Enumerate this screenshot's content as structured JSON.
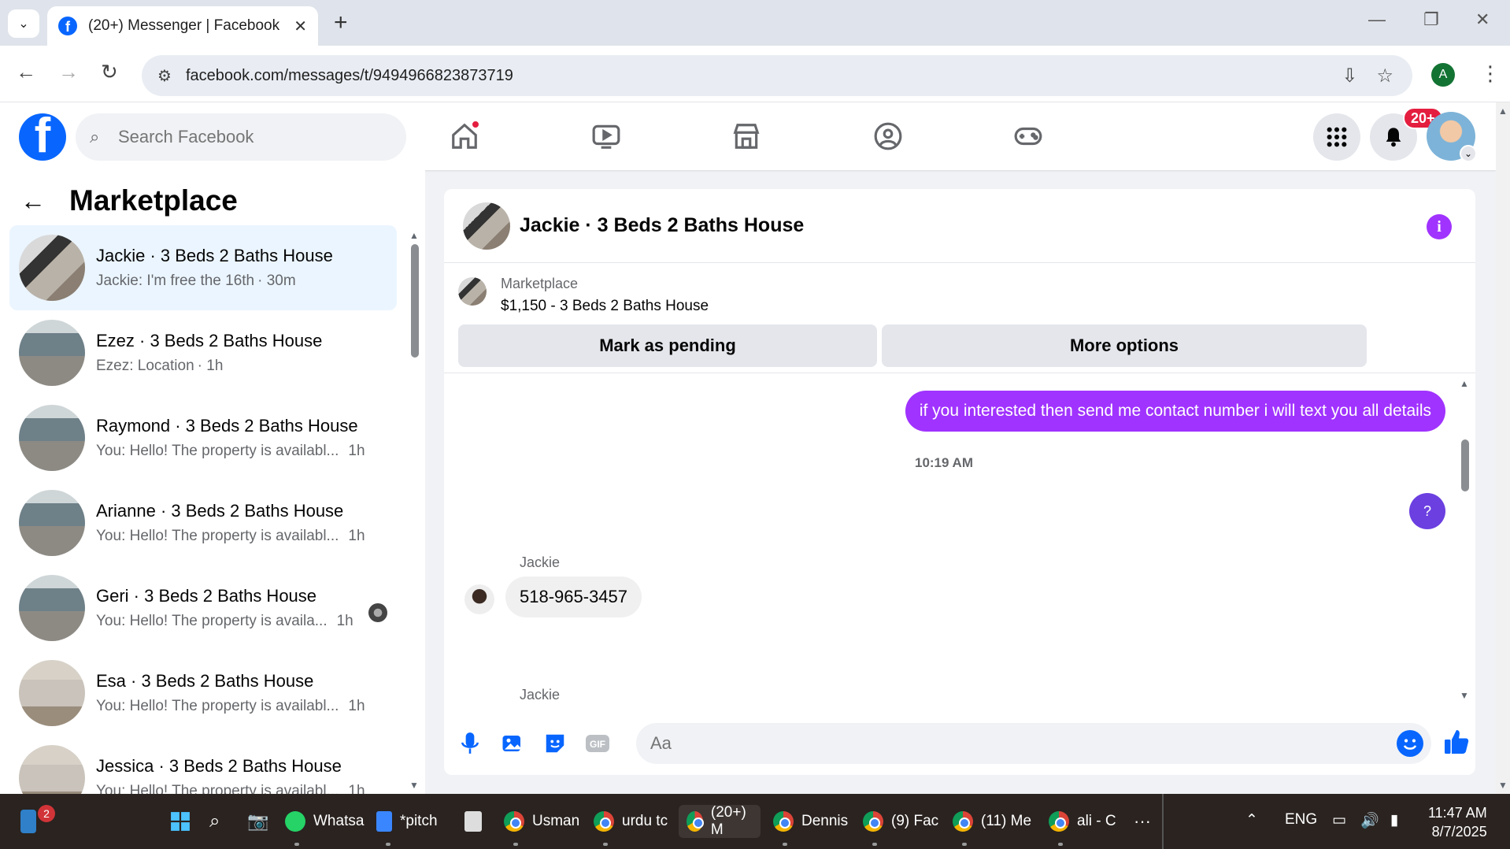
{
  "browser": {
    "tab_title": "(20+) Messenger | Facebook",
    "url": "facebook.com/messages/t/9494966823873719",
    "profile_initial": "A"
  },
  "fb": {
    "search_placeholder": "Search Facebook",
    "notification_badge": "20+"
  },
  "left_pane": {
    "title": "Marketplace",
    "conversations": [
      {
        "name": "Jackie · 3 Beds 2 Baths House",
        "preview": "Jackie: I'm free the 16th",
        "time": "· 30m",
        "active": true
      },
      {
        "name": "Ezez · 3 Beds 2 Baths House",
        "preview": "Ezez: Location",
        "time": "· 1h"
      },
      {
        "name": "Raymond · 3 Beds 2 Baths House",
        "preview": "You: Hello! The property is availabl...",
        "time": "1h"
      },
      {
        "name": "Arianne · 3 Beds 2 Baths House",
        "preview": "You: Hello! The property is availabl...",
        "time": "1h"
      },
      {
        "name": "Geri · 3 Beds 2 Baths House",
        "preview": "You: Hello! The property is availa...",
        "time": "1h"
      },
      {
        "name": "Esa · 3 Beds 2 Baths House",
        "preview": "You: Hello! The property is availabl...",
        "time": "1h"
      },
      {
        "name": "Jessica · 3 Beds 2 Baths House",
        "preview": "You: Hello! The property is availabl...",
        "time": "1h"
      }
    ]
  },
  "chat": {
    "title": "Jackie · 3 Beds 2 Baths House",
    "marketplace_label": "Marketplace",
    "listing": "$1,150 - 3 Beds 2 Baths House",
    "btn_pending": "Mark as pending",
    "btn_more": "More options",
    "outgoing_msg": "if you interested then send me contact number i will text you all details",
    "timestamp": "10:19 AM",
    "question_bubble": "?",
    "sender1": "Jackie",
    "incoming_msg": "518-965-3457",
    "sender2": "Jackie",
    "composer_placeholder": "Aa"
  },
  "taskbar": {
    "notif_count": "2",
    "items": [
      {
        "label": "Whatsа"
      },
      {
        "label": "*pitch"
      },
      {
        "label": "Usman"
      },
      {
        "label": "urdu tc"
      },
      {
        "label": "(20+) M"
      },
      {
        "label": "Dennis"
      },
      {
        "label": "(9) Fac"
      },
      {
        "label": "(11) Me"
      },
      {
        "label": "ali - C"
      }
    ],
    "lang": "ENG",
    "time": "11:47 AM",
    "date": "8/7/2025"
  }
}
